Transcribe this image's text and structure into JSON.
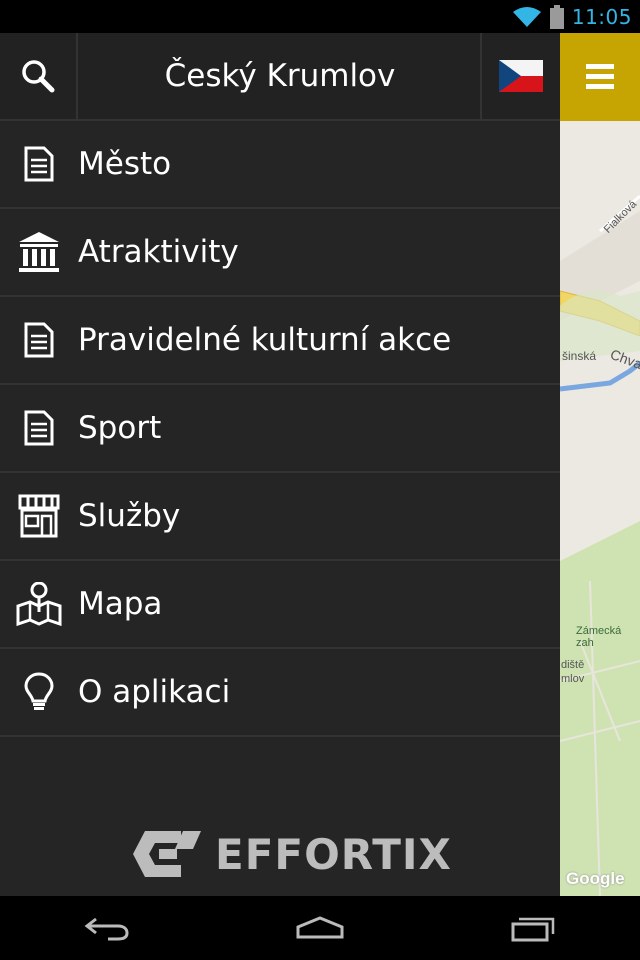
{
  "status_bar": {
    "time": "11:05"
  },
  "header": {
    "title": "Český Krumlov"
  },
  "menu": [
    {
      "label": "Město",
      "icon": "document-icon"
    },
    {
      "label": "Atraktivity",
      "icon": "museum-icon"
    },
    {
      "label": "Pravidelné kulturní akce",
      "icon": "document-icon"
    },
    {
      "label": "Sport",
      "icon": "document-icon"
    },
    {
      "label": "Služby",
      "icon": "shop-icon"
    },
    {
      "label": "Mapa",
      "icon": "map-pin-icon"
    },
    {
      "label": "O aplikaci",
      "icon": "lightbulb-icon"
    }
  ],
  "map": {
    "labels": [
      "Fialková",
      "Chva",
      "šinská",
      "Zámecká zah",
      "diště",
      "mlov"
    ],
    "attribution": "Google"
  },
  "brand": {
    "name": "EFFORTIX"
  },
  "colors": {
    "accent": "#c6a402",
    "drawer_bg": "#252525",
    "status_clock": "#33b5e5"
  }
}
